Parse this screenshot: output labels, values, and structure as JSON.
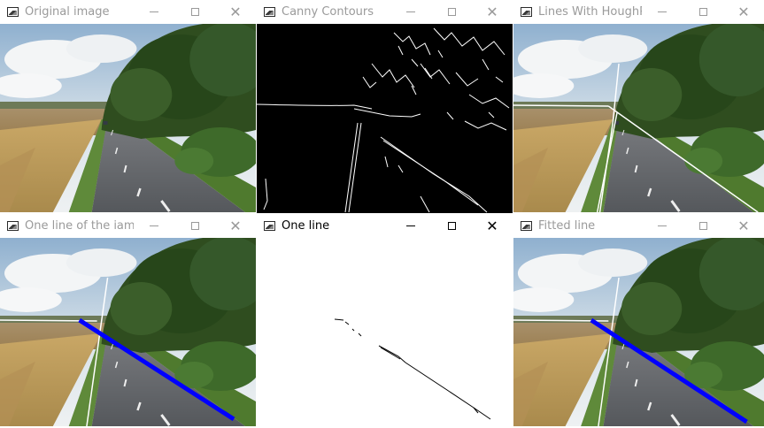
{
  "windows": [
    {
      "title": "Original image",
      "content": "road-photo",
      "icons": {
        "app": "opencv-window-icon",
        "minimize": "minimize-icon",
        "maximize": "maximize-icon",
        "close": "close-icon"
      }
    },
    {
      "title": "Canny Contours",
      "content": "canny-edge-map",
      "icons": {
        "app": "opencv-window-icon",
        "minimize": "minimize-icon",
        "maximize": "maximize-icon",
        "close": "close-icon"
      }
    },
    {
      "title": "Lines With HoughP",
      "content": "road-photo-hough-lines",
      "icons": {
        "app": "opencv-window-icon",
        "minimize": "minimize-icon",
        "maximize": "maximize-icon",
        "close": "close-icon"
      }
    },
    {
      "title": "One line of the iam...",
      "content": "road-photo-one-line",
      "icons": {
        "app": "opencv-window-icon",
        "minimize": "minimize-icon",
        "maximize": "maximize-icon",
        "close": "close-icon"
      }
    },
    {
      "title": "One line",
      "content": "one-line-points",
      "active": true,
      "icons": {
        "app": "opencv-window-icon",
        "minimize": "minimize-icon",
        "maximize": "maximize-icon",
        "close": "close-icon"
      }
    },
    {
      "title": "Fitted line",
      "content": "road-photo-fitted-line",
      "icons": {
        "app": "opencv-window-icon",
        "minimize": "minimize-icon",
        "maximize": "maximize-icon",
        "close": "close-icon"
      }
    }
  ],
  "colors": {
    "fitted_line": "#0000ff",
    "hough_line": "#ffffff",
    "canny_background": "#000000",
    "one_line_background": "#ffffff"
  }
}
